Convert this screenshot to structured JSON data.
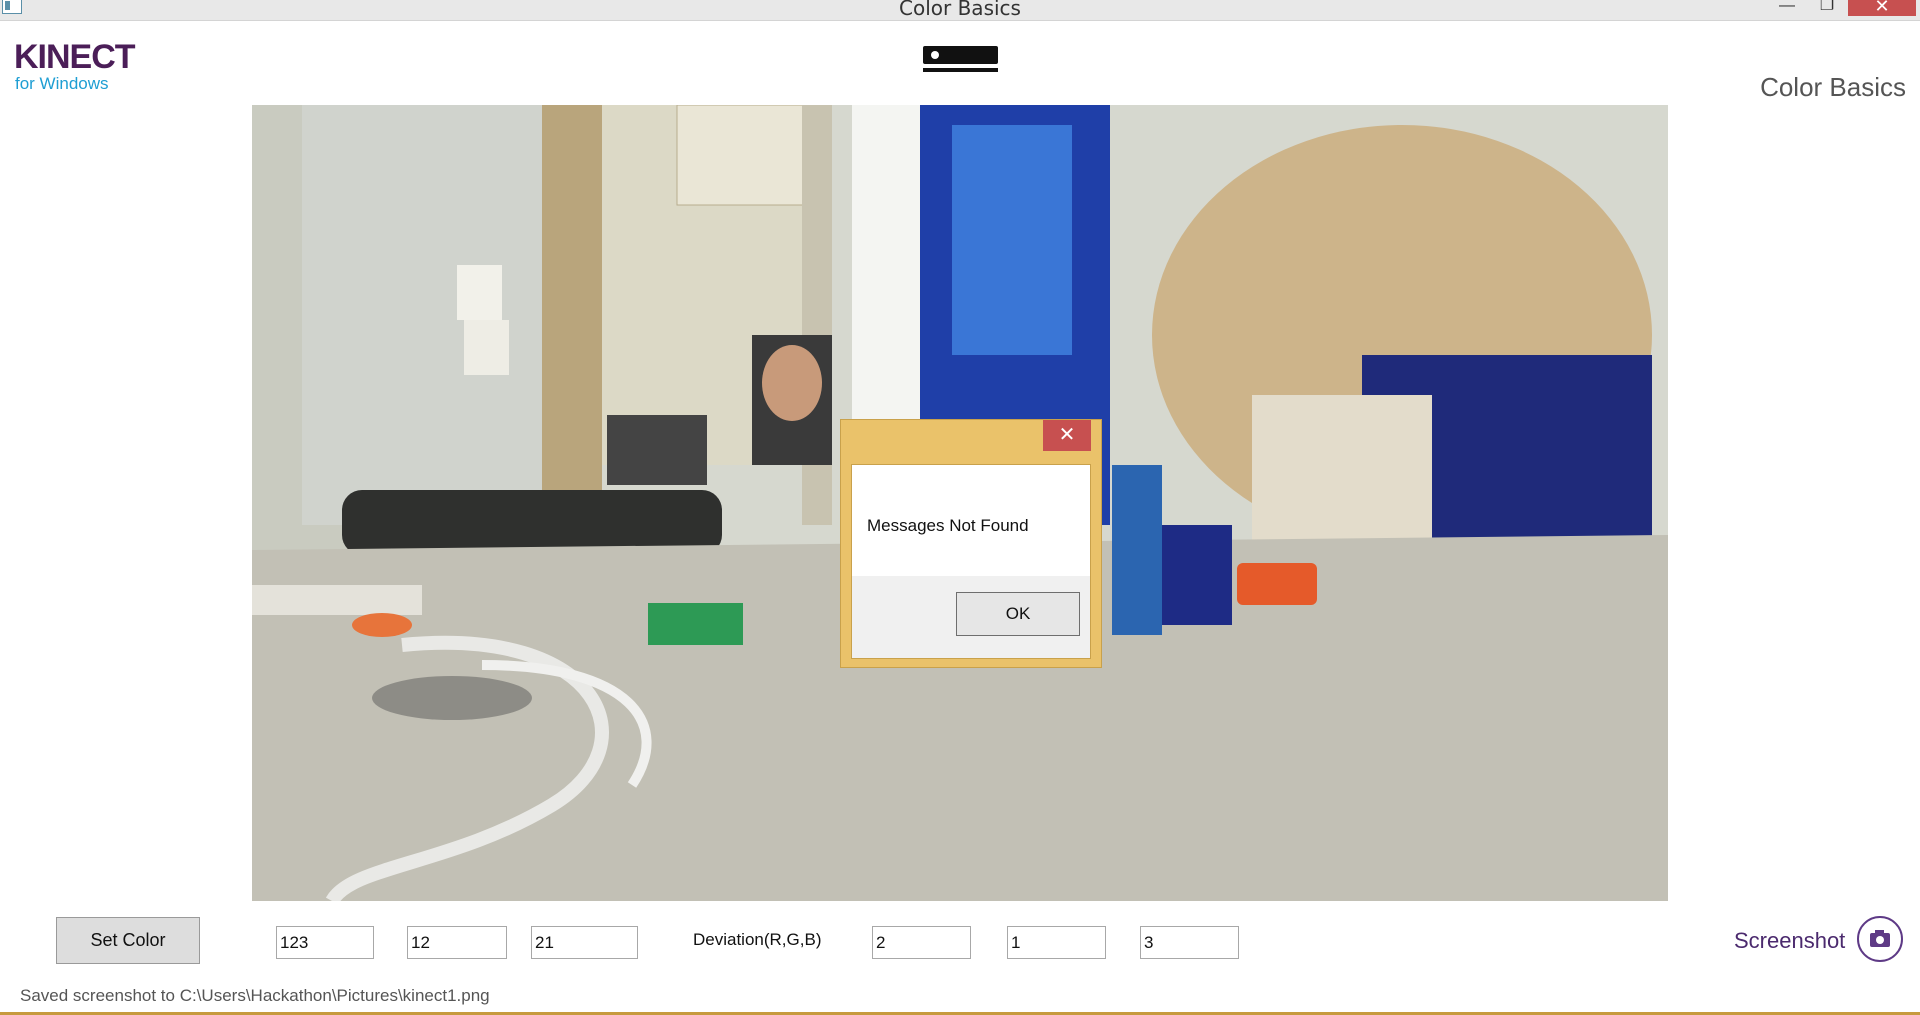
{
  "window": {
    "title": "Color Basics",
    "buttons": {
      "minimize": "—",
      "maximize": "❐",
      "close": "✕"
    }
  },
  "header": {
    "logo_main": "KINECT",
    "logo_sub": "for Windows",
    "app_title": "Color Basics",
    "sensor_icon": "kinect-sensor-icon"
  },
  "dialog": {
    "message": "Messages Not Found",
    "ok_label": "OK",
    "close_symbol": "✕"
  },
  "controls": {
    "set_color_label": "Set Color",
    "color_values": [
      "123",
      "12",
      "21"
    ],
    "deviation_label": "Deviation(R,G,B)",
    "deviation_values": [
      "2",
      "1",
      "3"
    ],
    "screenshot_label": "Screenshot",
    "camera_icon": "camera-icon"
  },
  "status": {
    "text": "Saved screenshot to C:\\Users\\Hackathon\\Pictures\\kinect1.png"
  },
  "colors": {
    "brand_purple": "#4b1e58",
    "brand_blue": "#1e9ed3",
    "dialog_border": "#eac26a",
    "close_red": "#c75050"
  }
}
